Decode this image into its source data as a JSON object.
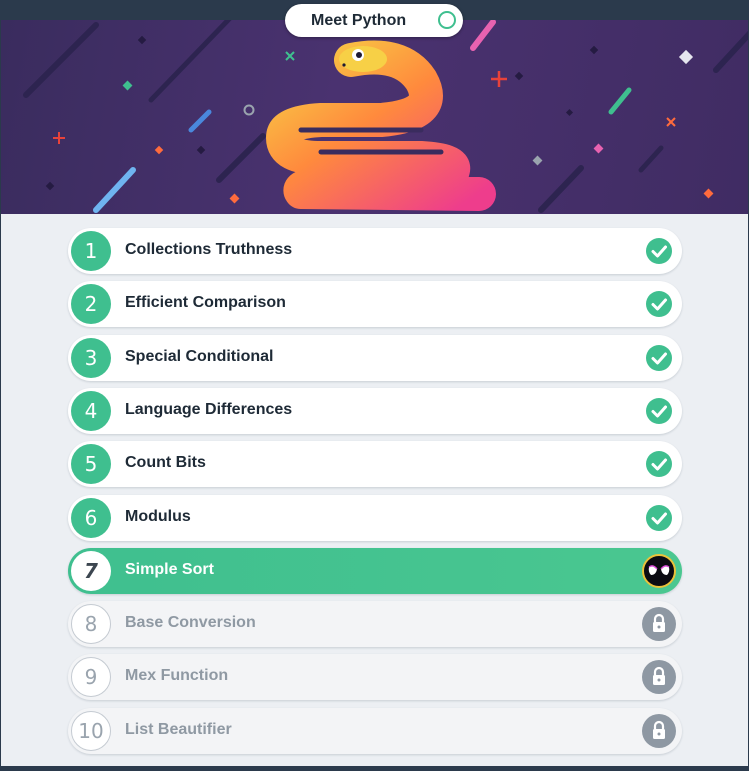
{
  "course": {
    "title": "Meet Python",
    "completion_icon": "circle-outline-icon",
    "banner_art": "snake-illustration"
  },
  "colors": {
    "accent": "#3fbf8f",
    "banner": "#43306a",
    "locked_text": "#8f99a3",
    "panel": "#eceff3"
  },
  "levels": [
    {
      "number": "1",
      "name": "Collections Truthness",
      "status": "completed",
      "icon": "checkmark-icon"
    },
    {
      "number": "2",
      "name": "Efficient Comparison",
      "status": "completed",
      "icon": "checkmark-icon"
    },
    {
      "number": "3",
      "name": "Special Conditional",
      "status": "completed",
      "icon": "checkmark-icon"
    },
    {
      "number": "4",
      "name": "Language Differences",
      "status": "completed",
      "icon": "checkmark-icon"
    },
    {
      "number": "5",
      "name": "Count Bits",
      "status": "completed",
      "icon": "checkmark-icon"
    },
    {
      "number": "6",
      "name": "Modulus",
      "status": "completed",
      "icon": "checkmark-icon"
    },
    {
      "number": "7",
      "name": "Simple Sort",
      "status": "current",
      "icon": "mask-avatar-icon"
    },
    {
      "number": "8",
      "name": "Base Conversion",
      "status": "locked",
      "icon": "lock-icon"
    },
    {
      "number": "9",
      "name": "Mex Function",
      "status": "locked",
      "icon": "lock-icon"
    },
    {
      "number": "10",
      "name": "List Beautifier",
      "status": "locked",
      "icon": "lock-icon"
    }
  ]
}
